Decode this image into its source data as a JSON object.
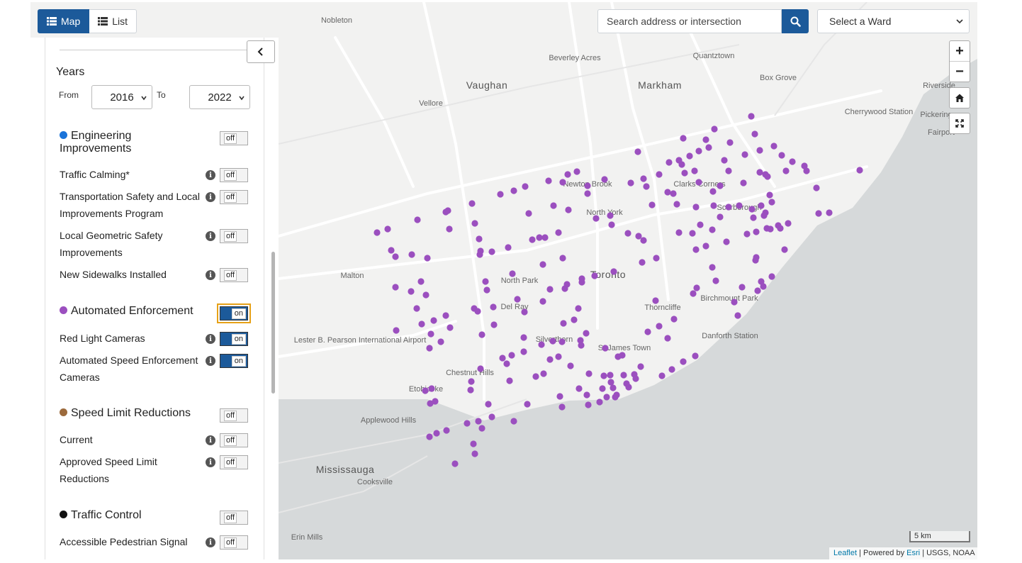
{
  "toolbar": {
    "map_label": "Map",
    "list_label": "List"
  },
  "search": {
    "placeholder": "Search address or intersection",
    "value": ""
  },
  "ward_select": {
    "value": "Select a Ward"
  },
  "map": {
    "labels": [
      "Nobleton",
      "Quantztown",
      "Beverley Acres",
      "Vaughan",
      "Markham",
      "Box Grove",
      "Riverside",
      "Vellore",
      "Cherrywood Station",
      "Pickering",
      "Fairport",
      "Newton Brook",
      "Clarks Corners",
      "North York",
      "Scarborough",
      "Malton",
      "North Park",
      "Toronto",
      "Birchmount Park",
      "Del Ray",
      "Thorncliffe",
      "Lester B. Pearson International Airport",
      "Silverthorn",
      "Danforth Station",
      "St James Town",
      "Chestnut Hills",
      "Etobicoke",
      "Applewood Hills",
      "Mississauga",
      "Cooksville",
      "Erin Mills"
    ],
    "marker_color": "#9b4fbf",
    "marker_category": "Automated Enforcement",
    "land_color": "#f2f2f1",
    "water_color": "#d6d9da"
  },
  "map_controls": {
    "zoom_in": "+",
    "zoom_out": "−",
    "home_icon": "home-icon",
    "fullscreen_icon": "fullscreen-icon"
  },
  "scale": "5 km",
  "attribution": {
    "leaflet": "Leaflet",
    "powered_by": "| Powered by",
    "esri": "Esri",
    "rest": "| USGS, NOAA"
  },
  "panel": {
    "years": {
      "title": "Years",
      "from_label": "From",
      "to_label": "To",
      "from_value": "2016",
      "to_value": "2022"
    },
    "sections": [
      {
        "name": "Engineering Improvements",
        "dot_color": "#1a73d9",
        "toggle": "off",
        "items": [
          {
            "label": "Traffic Calming*",
            "toggle": "off"
          },
          {
            "label": "Transportation Safety and Local Improvements Program",
            "toggle": "off"
          },
          {
            "label": "Local Geometric Safety Improvements",
            "toggle": "off"
          },
          {
            "label": "New Sidewalks Installed",
            "toggle": "off"
          }
        ]
      },
      {
        "name": "Automated Enforcement",
        "dot_color": "#9b4fbf",
        "toggle": "on",
        "items": [
          {
            "label": "Red Light Cameras",
            "toggle": "on"
          },
          {
            "label": "Automated Speed Enforcement Cameras",
            "toggle": "on"
          }
        ]
      },
      {
        "name": "Speed Limit Reductions",
        "dot_color": "#9c6a3c",
        "toggle": "off",
        "items": [
          {
            "label": "Current",
            "toggle": "off"
          },
          {
            "label": "Approved Speed Limit Reductions",
            "toggle": "off"
          }
        ]
      },
      {
        "name": "Traffic Control",
        "dot_color": "#111111",
        "toggle": "off",
        "items": [
          {
            "label": "Accessible Pedestrian Signal",
            "toggle": "off"
          }
        ]
      }
    ]
  }
}
